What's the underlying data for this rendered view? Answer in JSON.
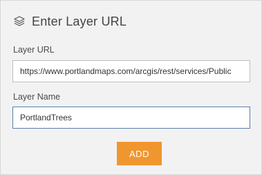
{
  "header": {
    "icon": "layers-icon",
    "title": "Enter Layer URL"
  },
  "layer_url": {
    "label": "Layer URL",
    "value": "https://www.portlandmaps.com/arcgis/rest/services/Public"
  },
  "layer_name": {
    "label": "Layer Name",
    "value": "PortlandTrees"
  },
  "actions": {
    "add_label": "ADD"
  },
  "colors": {
    "panel_background": "#f2f2f2",
    "add_button": "#f0962f",
    "focused_border": "#5a7da8"
  }
}
